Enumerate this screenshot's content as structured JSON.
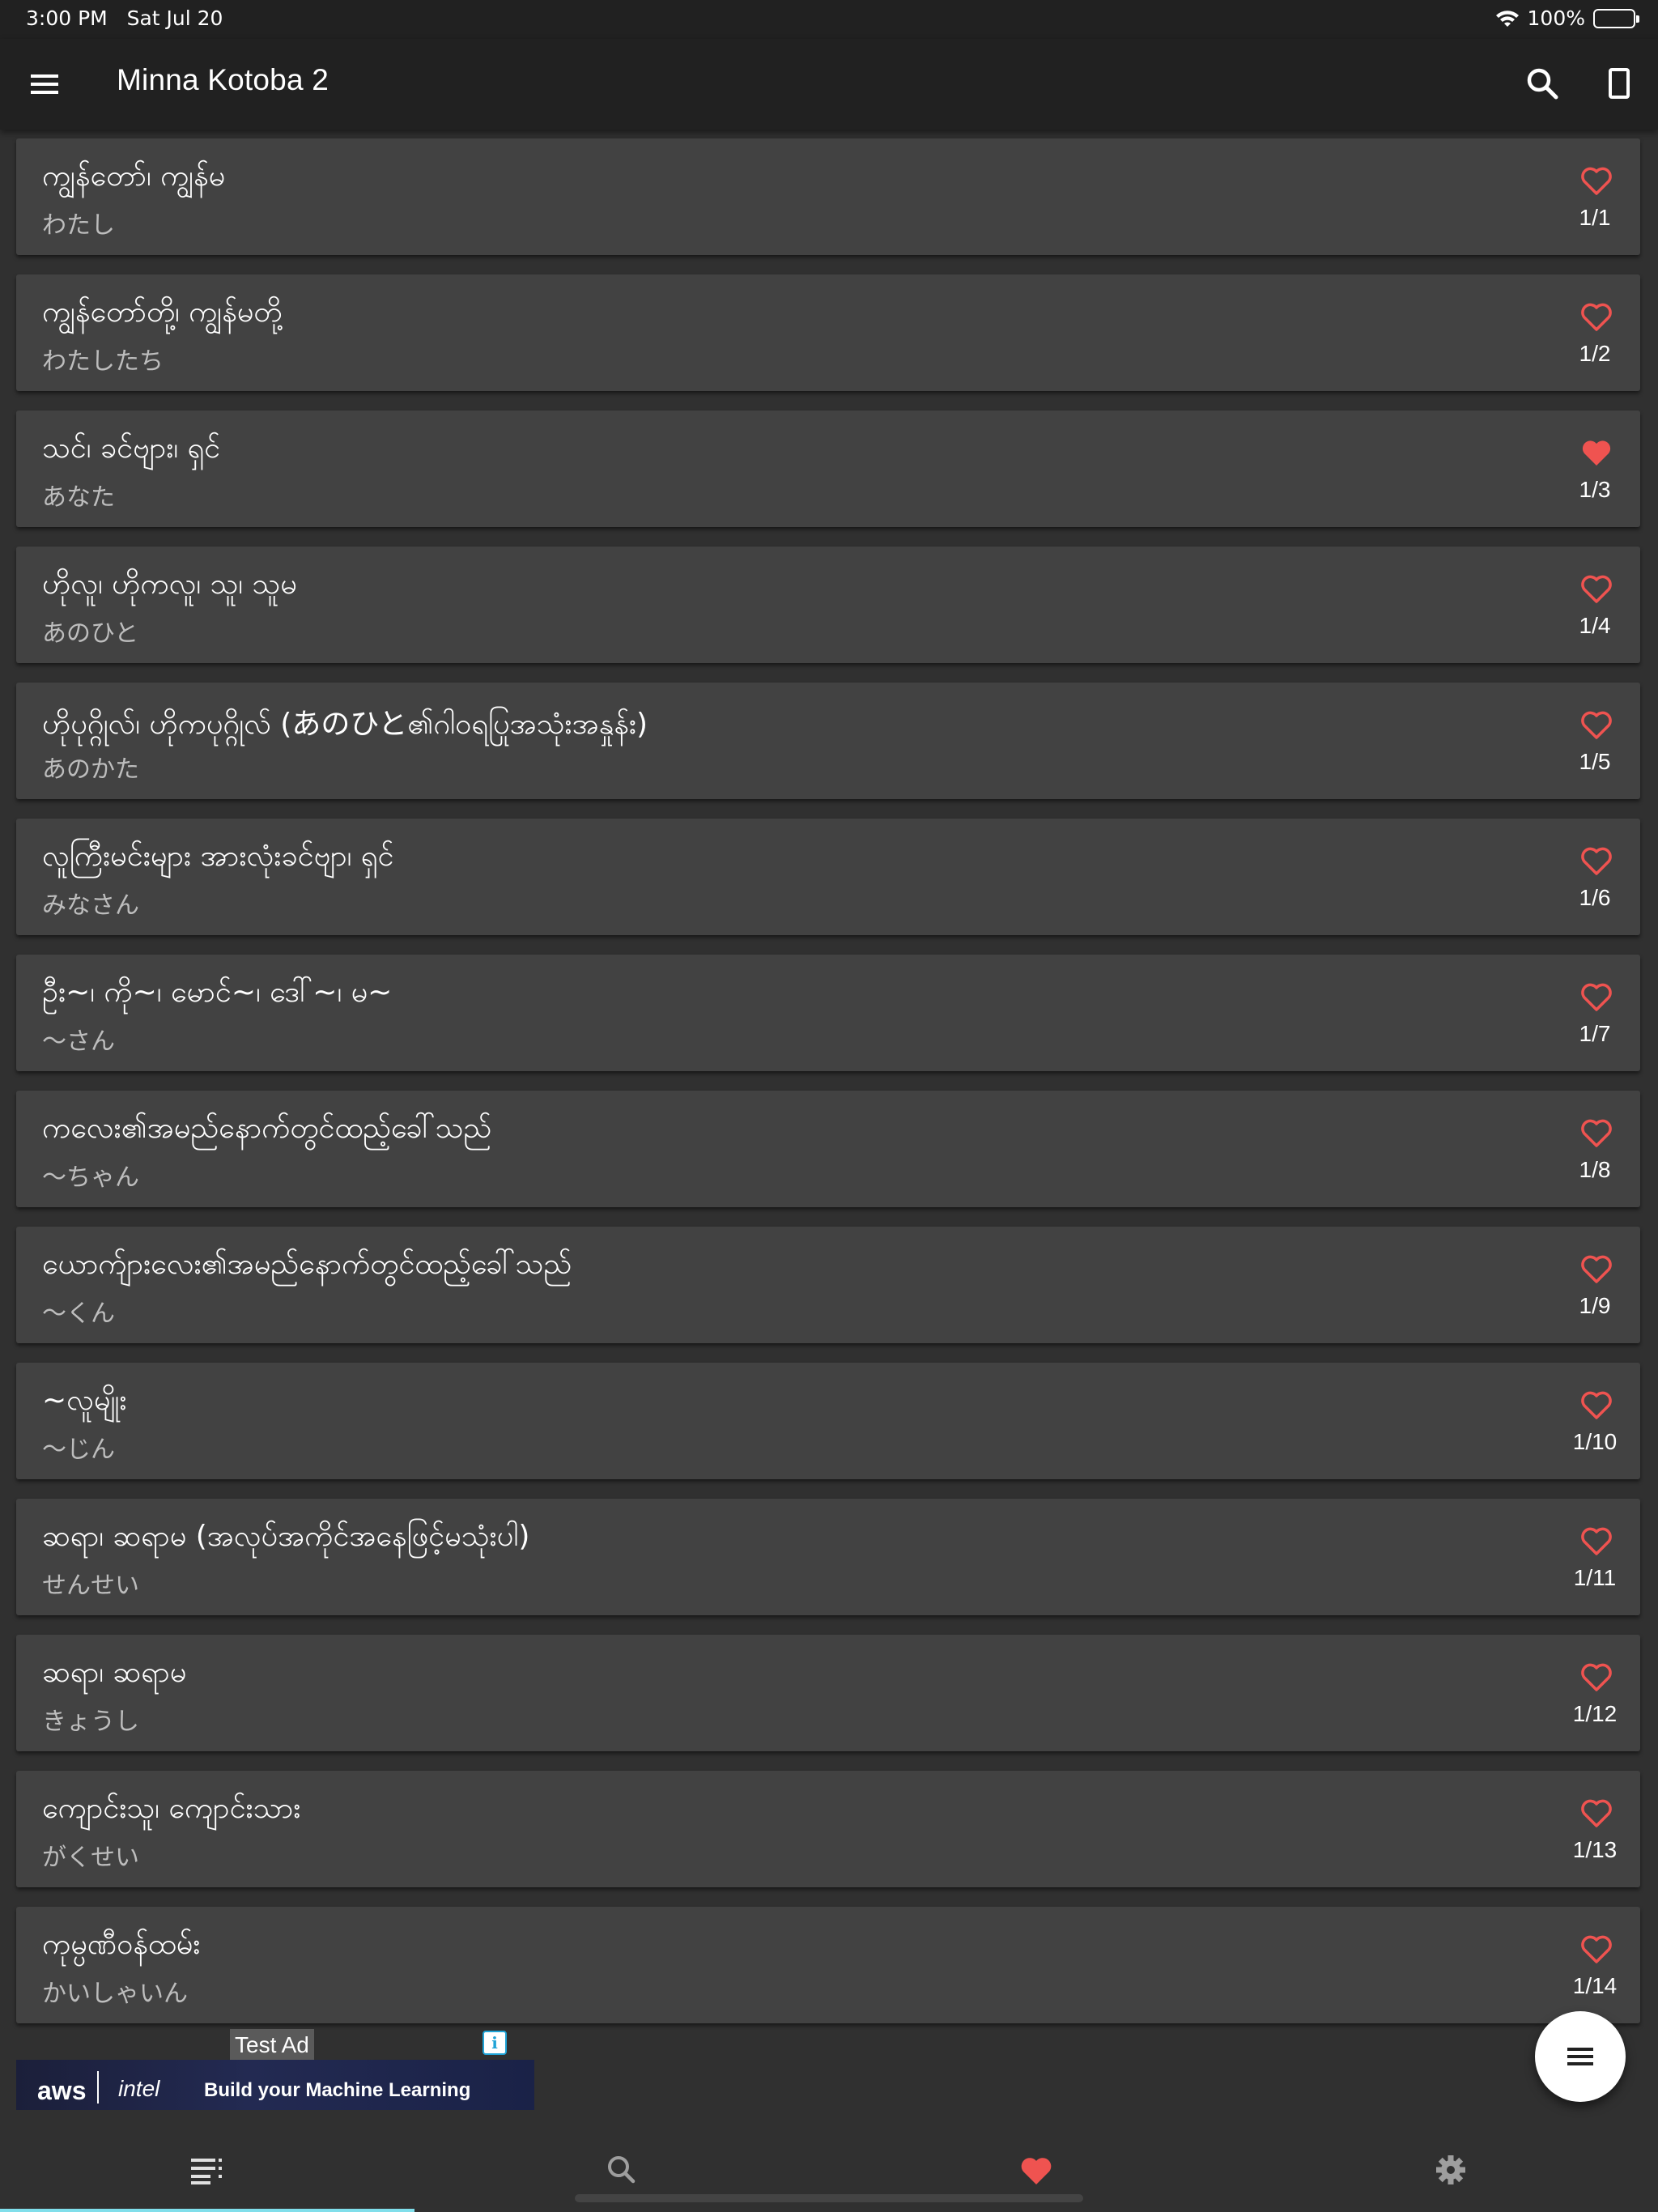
{
  "status_bar": {
    "time": "3:00 PM",
    "date": "Sat Jul 20",
    "battery": "100%"
  },
  "app_bar": {
    "title": "Minna Kotoba 2"
  },
  "colors": {
    "heart": "#ef5350",
    "accent_indicator": "#80deea",
    "card_bg": "#424242",
    "page_bg": "#303030"
  },
  "vocabulary": [
    {
      "word": "ကျွန်တော်၊ ကျွန်မ",
      "reading": "わたし",
      "number": "1/1",
      "favorite": false
    },
    {
      "word": "ကျွန်တော်တို့၊ ကျွန်မတို့",
      "reading": "わたしたち",
      "number": "1/2",
      "favorite": false
    },
    {
      "word": "သင်၊ ခင်ဗျား၊ ရှင်",
      "reading": "あなた",
      "number": "1/3",
      "favorite": true
    },
    {
      "word": "ဟိုလူ၊ ဟိုကလူ၊ သူ၊ သူမ",
      "reading": "あのひと",
      "number": "1/4",
      "favorite": false
    },
    {
      "word": "ဟိုပုဂ္ဂိုလ်၊ ဟိုကပုဂ္ဂိုလ် (あのひと၏ဂါဝရပြုအသုံးအနှုန်း)",
      "reading": "あのかた",
      "number": "1/5",
      "favorite": false
    },
    {
      "word": "လူကြီးမင်းများ အားလုံးခင်ဗျာ၊ ရှင်",
      "reading": "みなさん",
      "number": "1/6",
      "favorite": false
    },
    {
      "word": "ဦး~၊ ကို~၊ မောင်~၊ ဒေါ်~၊ မ~",
      "reading": "～さん",
      "number": "1/7",
      "favorite": false
    },
    {
      "word": "ကလေး၏အမည်နောက်တွင်ထည့်ခေါ်သည်",
      "reading": "～ちゃん",
      "number": "1/8",
      "favorite": false
    },
    {
      "word": "ယောက်ျားလေး၏အမည်နောက်တွင်ထည့်ခေါ်သည်",
      "reading": "～くん",
      "number": "1/9",
      "favorite": false
    },
    {
      "word": "~လူမျိုး",
      "reading": "～じん",
      "number": "1/10",
      "favorite": false
    },
    {
      "word": "ဆရာ၊ ဆရာမ (အလုပ်အကိုင်အနေဖြင့်မသုံးပါ)",
      "reading": "せんせい",
      "number": "1/11",
      "favorite": false
    },
    {
      "word": "ဆရာ၊ ဆရာမ",
      "reading": "きょうし",
      "number": "1/12",
      "favorite": false
    },
    {
      "word": "ကျောင်းသူ၊ ကျောင်းသား",
      "reading": "がくせい",
      "number": "1/13",
      "favorite": false
    },
    {
      "word": "ကုမ္ပဏီဝန်ထမ်း",
      "reading": "かいしゃいん",
      "number": "1/14",
      "favorite": false
    }
  ],
  "ad": {
    "label": "Test Ad",
    "brand_aws": "aws",
    "brand_intel": "intel",
    "headline": "Build your Machine Learning"
  },
  "bottom_nav": {
    "tabs": [
      {
        "icon": "list-icon",
        "active": true
      },
      {
        "icon": "search-icon",
        "active": false
      },
      {
        "icon": "heart-icon",
        "active": false
      },
      {
        "icon": "settings-icon",
        "active": false
      }
    ]
  }
}
